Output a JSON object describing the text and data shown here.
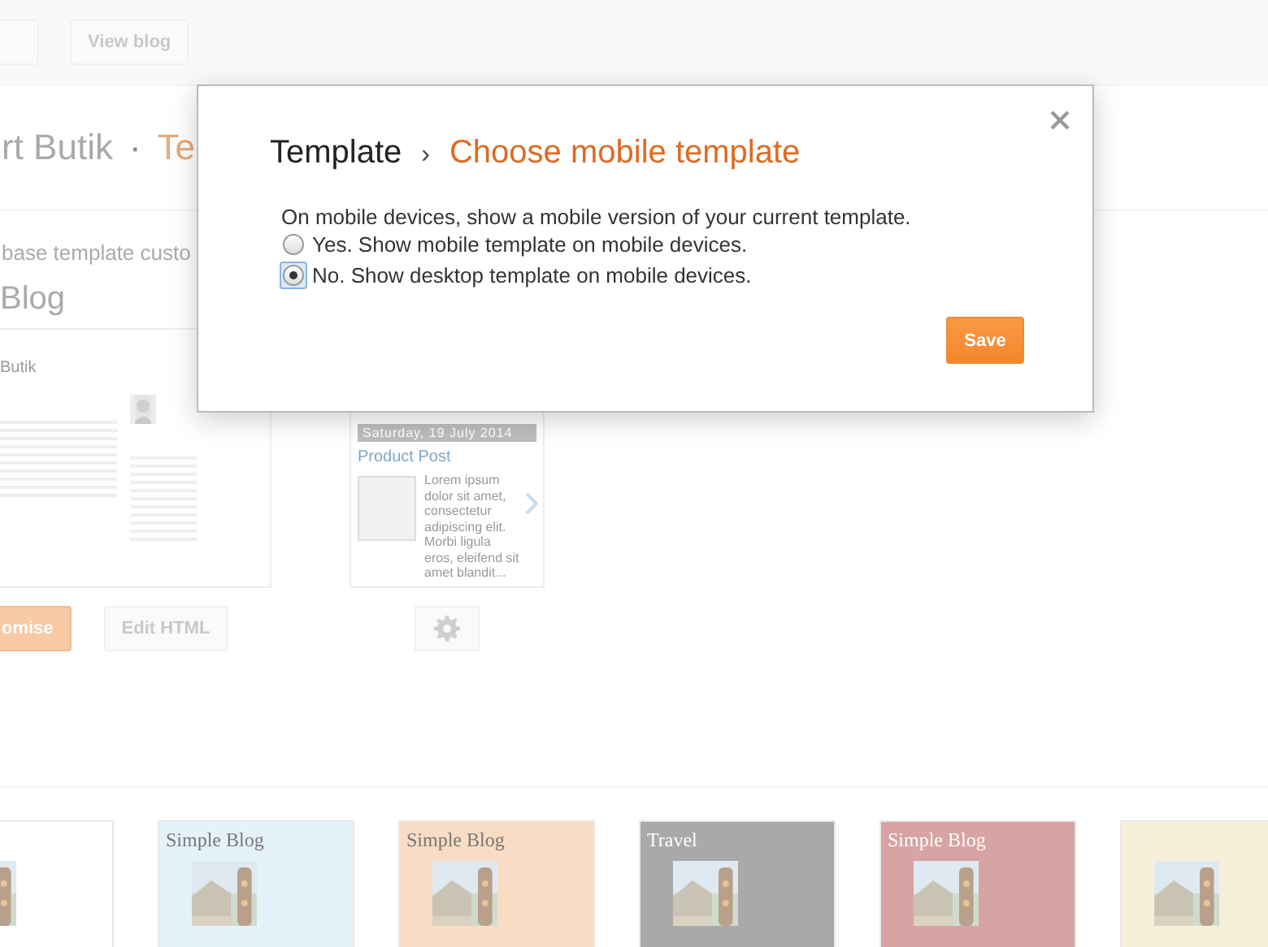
{
  "top_bar": {
    "view_blog": "View blog"
  },
  "header": {
    "blog_name": "rt Butik",
    "separator": "·",
    "section": "Te"
  },
  "subtitle": "base template custo",
  "heading": "Blog",
  "desktop_preview": {
    "blog_title": "Butik",
    "buttons": [
      {
        "label": "omise",
        "kind": "primary"
      },
      {
        "label": "Edit HTML",
        "kind": "secondary"
      }
    ]
  },
  "mobile_preview": {
    "date": "Saturday, 19 July 2014",
    "post_title": "Product Post",
    "excerpt": "Lorem ipsum dolor sit amet, consectetur adipiscing elit. Morbi ligula eros, eleifend sit amet blandit..."
  },
  "gallery": [
    {
      "color": "#ffffff"
    },
    {
      "title": "Simple Blog",
      "color": "#e6f2fa"
    },
    {
      "title": "Simple Blog",
      "color": "#f8dcc4"
    },
    {
      "title": "Travel",
      "color": "#a9a9a9"
    },
    {
      "title": "Simple Blog",
      "color": "#d7a3a3"
    },
    {
      "color": "#f6efd9"
    }
  ],
  "dialog": {
    "breadcrumb": "Template",
    "separator": "›",
    "title": "Choose mobile template",
    "description": "On mobile devices, show a mobile version of your current template.",
    "options": [
      {
        "label": "Yes. Show mobile template on mobile devices.",
        "selected": false
      },
      {
        "label": "No. Show desktop template on mobile devices.",
        "selected": true
      }
    ],
    "save": "Save"
  }
}
